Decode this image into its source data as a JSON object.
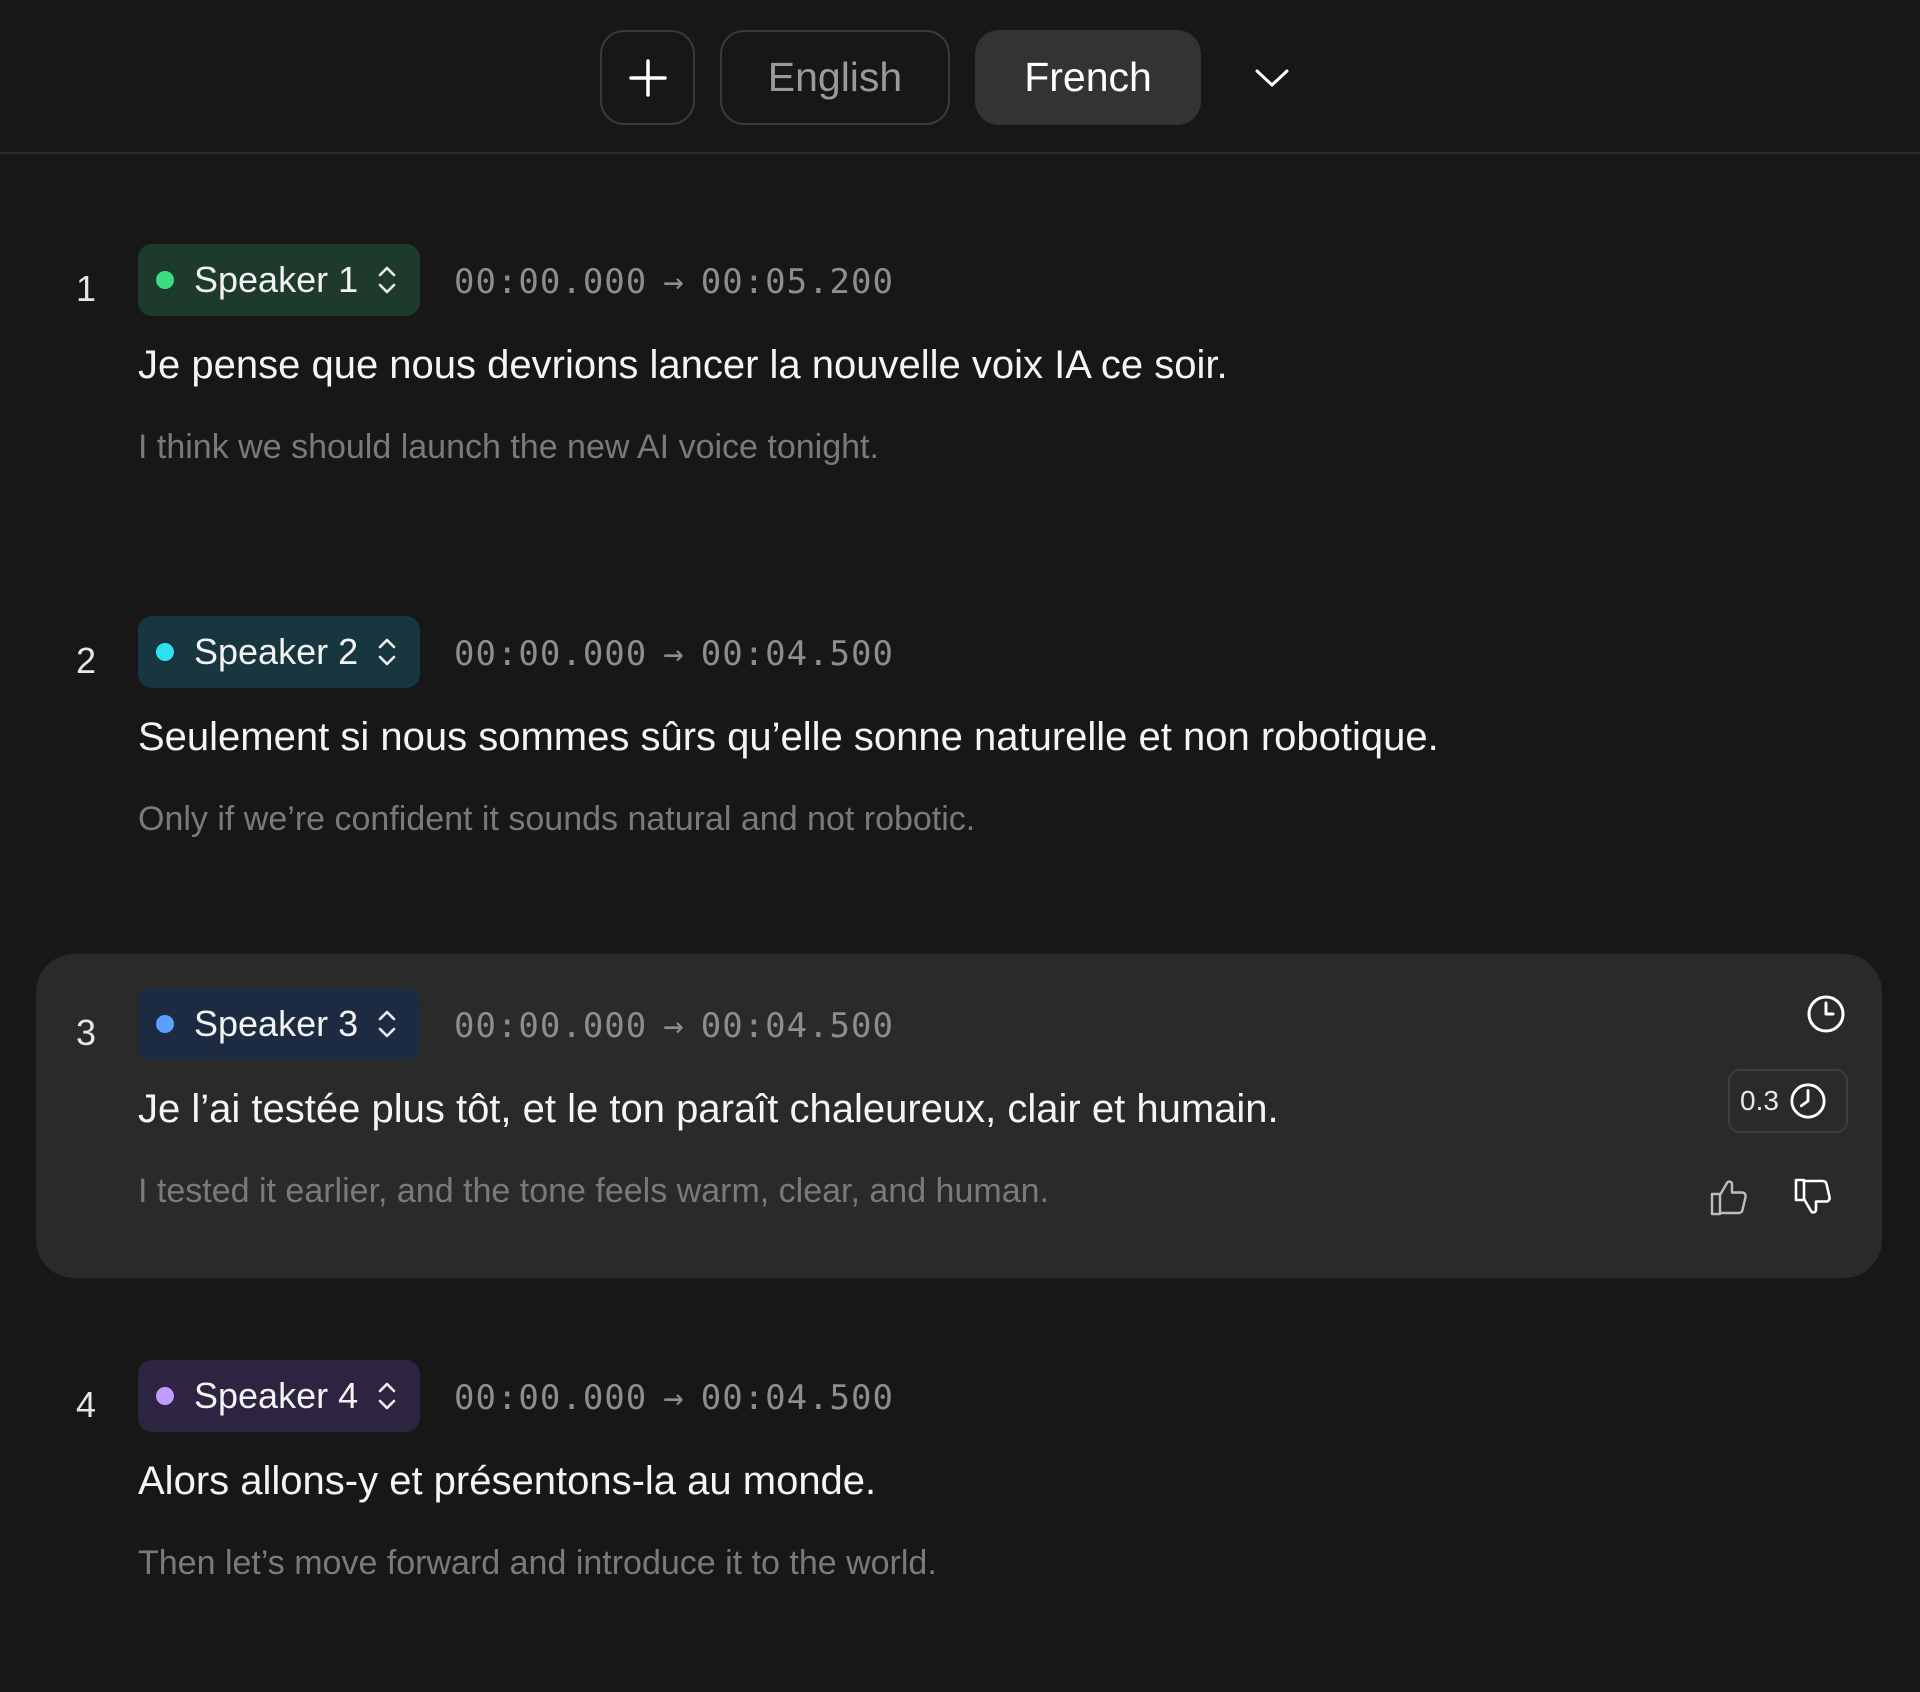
{
  "toolbar": {
    "add_icon": "plus-icon",
    "languages": [
      "English",
      "French"
    ],
    "selected_language": "French",
    "dropdown_icon": "chevron-down-icon"
  },
  "segments": [
    {
      "number": "1",
      "speaker": "Speaker 1",
      "speaker_color": "#3ddc84",
      "pill_bg": "#1d3a2c",
      "start": "00:00.000",
      "arrow": "→",
      "end": "00:05.200",
      "original": "Je pense que nous devrions lancer la nouvelle voix IA ce soir.",
      "translation": "I think we should launch the new AI voice tonight."
    },
    {
      "number": "2",
      "speaker": "Speaker 2",
      "speaker_color": "#2ee0f0",
      "pill_bg": "#173640",
      "start": "00:00.000",
      "arrow": "→",
      "end": "00:04.500",
      "original": "Seulement si nous sommes sûrs qu’elle sonne naturelle et non robotique.",
      "translation": "Only if we’re confident it sounds natural and not robotic."
    },
    {
      "number": "3",
      "speaker": "Speaker 3",
      "speaker_color": "#5aa0ff",
      "pill_bg": "#1c2a42",
      "start": "00:00.000",
      "arrow": "→",
      "end": "00:04.500",
      "original": "Je l’ai testée plus tôt, et le ton paraît chaleureux, clair et humain.",
      "translation": "I tested it earlier, and the tone feels warm, clear, and human.",
      "active": true,
      "speed": "0.3"
    },
    {
      "number": "4",
      "speaker": "Speaker 4",
      "speaker_color": "#c39bff",
      "pill_bg": "#2c2440",
      "start": "00:00.000",
      "arrow": "→",
      "end": "00:04.500",
      "original": "Alors allons-y et présentons-la au monde.",
      "translation": "Then let’s move forward and introduce it to the world."
    }
  ]
}
